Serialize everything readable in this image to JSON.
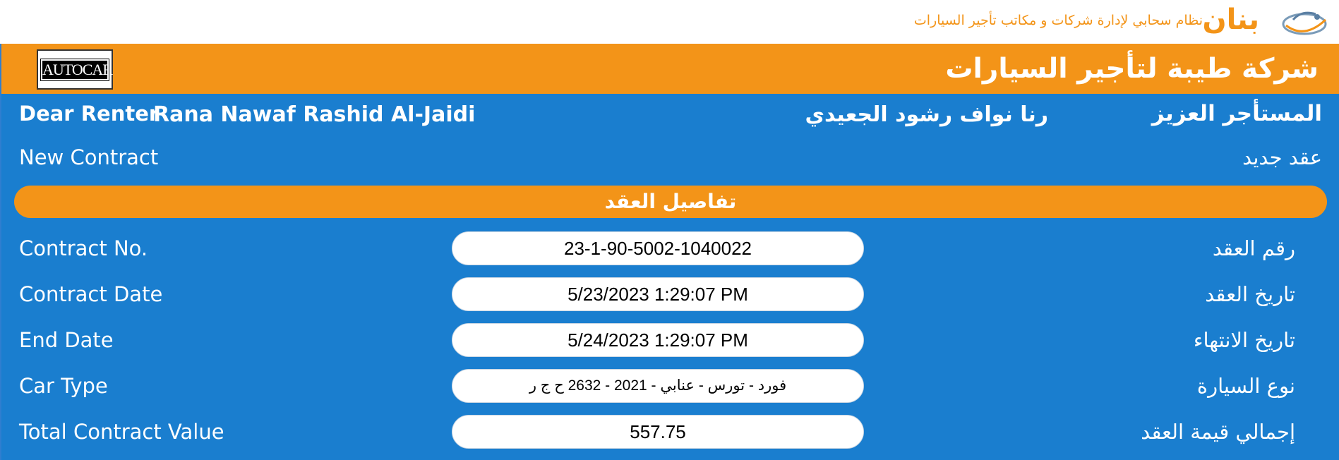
{
  "brand": {
    "name": "بنان",
    "tagline": "نظام سحابي لإدارة شركات و مكاتب تأجير السيارات",
    "accent_color": "#f39418"
  },
  "company": {
    "name": "شركة طيبة لتأجير السيارات",
    "partner_logo_text": "AUTOCAR"
  },
  "greeting": {
    "en_label": "Dear Renter",
    "en_name": "Rana Nawaf Rashid Al-Jaidi",
    "ar_name": "رنا نواف رشود الجعيدي",
    "ar_label": "المستأجر العزيز"
  },
  "contract_status": {
    "en": "New Contract",
    "ar": "عقد جديد"
  },
  "section": {
    "title": "تفاصيل العقد"
  },
  "details": [
    {
      "en": "Contract No.",
      "value": "23-1-90-5002-1040022",
      "ar": "رقم العقد"
    },
    {
      "en": "Contract Date",
      "value": "5/23/2023 1:29:07 PM",
      "ar": "تاريخ العقد"
    },
    {
      "en": "End Date",
      "value": "5/24/2023 1:29:07 PM",
      "ar": "تاريخ الانتهاء"
    },
    {
      "en": "Car Type",
      "value": "فورد - تورس - عنابي - 2021 - 2632 ح ج ر",
      "ar": "نوع السيارة"
    },
    {
      "en": "Total Contract Value",
      "value": "557.75",
      "ar": "إجمالي قيمة العقد"
    }
  ],
  "colors": {
    "panel_blue": "#1a7ecf",
    "header_orange": "#f39418"
  }
}
